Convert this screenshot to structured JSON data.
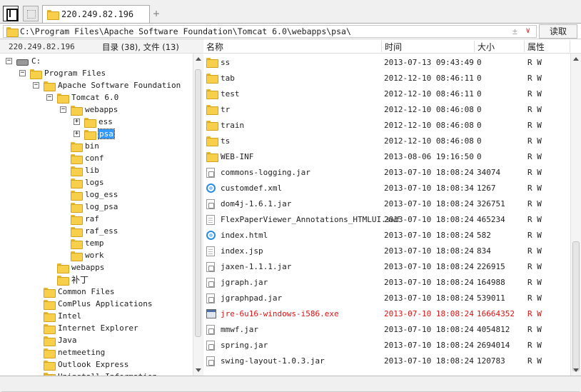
{
  "tab": {
    "title": "220.249.82.196",
    "add": "+"
  },
  "address": {
    "path": "C:\\Program Files\\Apache Software Foundation\\Tomcat 6.0\\webapps\\psa\\",
    "pin": "±",
    "dropdown": "∨",
    "read_label": "读取"
  },
  "left": {
    "host": "220.249.82.196",
    "stats": "目录 (38), 文件 (13)",
    "tree": [
      {
        "label": "C:",
        "toggle": "⊟",
        "type": "drive"
      },
      {
        "label": "Program Files",
        "toggle": "−",
        "type": "folder"
      },
      {
        "label": "Apache Software Foundation",
        "toggle": "−",
        "type": "folder"
      },
      {
        "label": "Tomcat 6.0",
        "toggle": "−",
        "type": "folder"
      },
      {
        "label": "webapps",
        "toggle": "−",
        "type": "folder"
      },
      {
        "label": "ess",
        "toggle": "+",
        "type": "folder"
      },
      {
        "label": "psa",
        "toggle": "+",
        "type": "folder",
        "selected": true
      },
      {
        "label": "bin",
        "toggle": "",
        "type": "folder"
      },
      {
        "label": "conf",
        "toggle": "",
        "type": "folder"
      },
      {
        "label": "lib",
        "toggle": "",
        "type": "folder"
      },
      {
        "label": "logs",
        "toggle": "",
        "type": "folder"
      },
      {
        "label": "log_ess",
        "toggle": "",
        "type": "folder"
      },
      {
        "label": "log_psa",
        "toggle": "",
        "type": "folder"
      },
      {
        "label": "raf",
        "toggle": "",
        "type": "folder"
      },
      {
        "label": "raf_ess",
        "toggle": "",
        "type": "folder"
      },
      {
        "label": "temp",
        "toggle": "",
        "type": "folder"
      },
      {
        "label": "work",
        "toggle": "",
        "type": "folder"
      },
      {
        "label": "webapps",
        "toggle": "",
        "type": "folder"
      },
      {
        "label": "补丁",
        "toggle": "",
        "type": "folder"
      },
      {
        "label": "Common Files",
        "toggle": "",
        "type": "folder"
      },
      {
        "label": "ComPlus Applications",
        "toggle": "",
        "type": "folder"
      },
      {
        "label": "Intel",
        "toggle": "",
        "type": "folder"
      },
      {
        "label": "Internet Explorer",
        "toggle": "",
        "type": "folder"
      },
      {
        "label": "Java",
        "toggle": "",
        "type": "folder"
      },
      {
        "label": "netmeeting",
        "toggle": "",
        "type": "folder"
      },
      {
        "label": "Outlook Express",
        "toggle": "",
        "type": "folder"
      },
      {
        "label": "Uninstall Information",
        "toggle": "",
        "type": "folder"
      }
    ]
  },
  "right": {
    "columns": {
      "name": "名称",
      "time": "时间",
      "size": "大小",
      "attr": "属性"
    },
    "rows": [
      {
        "name": "ss",
        "time": "2013-07-13 09:43:49",
        "size": "0",
        "attr": "R W",
        "icon": "folder"
      },
      {
        "name": "tab",
        "time": "2012-12-10 08:46:11",
        "size": "0",
        "attr": "R W",
        "icon": "folder"
      },
      {
        "name": "test",
        "time": "2012-12-10 08:46:11",
        "size": "0",
        "attr": "R W",
        "icon": "folder"
      },
      {
        "name": "tr",
        "time": "2012-12-10 08:46:08",
        "size": "0",
        "attr": "R W",
        "icon": "folder"
      },
      {
        "name": "train",
        "time": "2012-12-10 08:46:08",
        "size": "0",
        "attr": "R W",
        "icon": "folder"
      },
      {
        "name": "ts",
        "time": "2012-12-10 08:46:08",
        "size": "0",
        "attr": "R W",
        "icon": "folder"
      },
      {
        "name": "WEB-INF",
        "time": "2013-08-06 19:16:50",
        "size": "0",
        "attr": "R W",
        "icon": "folder"
      },
      {
        "name": "commons-logging.jar",
        "time": "2013-07-10 18:08:24",
        "size": "34074",
        "attr": "R W",
        "icon": "jar"
      },
      {
        "name": "customdef.xml",
        "time": "2013-07-10 18:08:34",
        "size": "1267",
        "attr": "R W",
        "icon": "globe"
      },
      {
        "name": "dom4j-1.6.1.jar",
        "time": "2013-07-10 18:08:24",
        "size": "326751",
        "attr": "R W",
        "icon": "jar"
      },
      {
        "name": "FlexPaperViewer_Annotations_HTMLUI.swf",
        "time": "2013-07-10 18:08:24",
        "size": "465234",
        "attr": "R W",
        "icon": "doc"
      },
      {
        "name": "index.html",
        "time": "2013-07-10 18:08:24",
        "size": "582",
        "attr": "R W",
        "icon": "globe"
      },
      {
        "name": "index.jsp",
        "time": "2013-07-10 18:08:24",
        "size": "834",
        "attr": "R W",
        "icon": "doc"
      },
      {
        "name": "jaxen-1.1.1.jar",
        "time": "2013-07-10 18:08:24",
        "size": "226915",
        "attr": "R W",
        "icon": "jar"
      },
      {
        "name": "jgraph.jar",
        "time": "2013-07-10 18:08:24",
        "size": "164988",
        "attr": "R W",
        "icon": "jar"
      },
      {
        "name": "jgraphpad.jar",
        "time": "2013-07-10 18:08:24",
        "size": "539011",
        "attr": "R W",
        "icon": "jar"
      },
      {
        "name": "jre-6u16-windows-i586.exe",
        "time": "2013-07-10 18:08:24",
        "size": "16664352",
        "attr": "R W",
        "icon": "exe",
        "highlight": true
      },
      {
        "name": "mmwf.jar",
        "time": "2013-07-10 18:08:24",
        "size": "4054812",
        "attr": "R W",
        "icon": "jar"
      },
      {
        "name": "spring.jar",
        "time": "2013-07-10 18:08:24",
        "size": "2694014",
        "attr": "R W",
        "icon": "jar"
      },
      {
        "name": "swing-layout-1.0.3.jar",
        "time": "2013-07-10 18:08:24",
        "size": "120783",
        "attr": "R W",
        "icon": "jar"
      }
    ]
  },
  "colors": {
    "selection": "#3399ff",
    "highlight_text": "#dd1111",
    "folder": "#f7cf4a"
  }
}
